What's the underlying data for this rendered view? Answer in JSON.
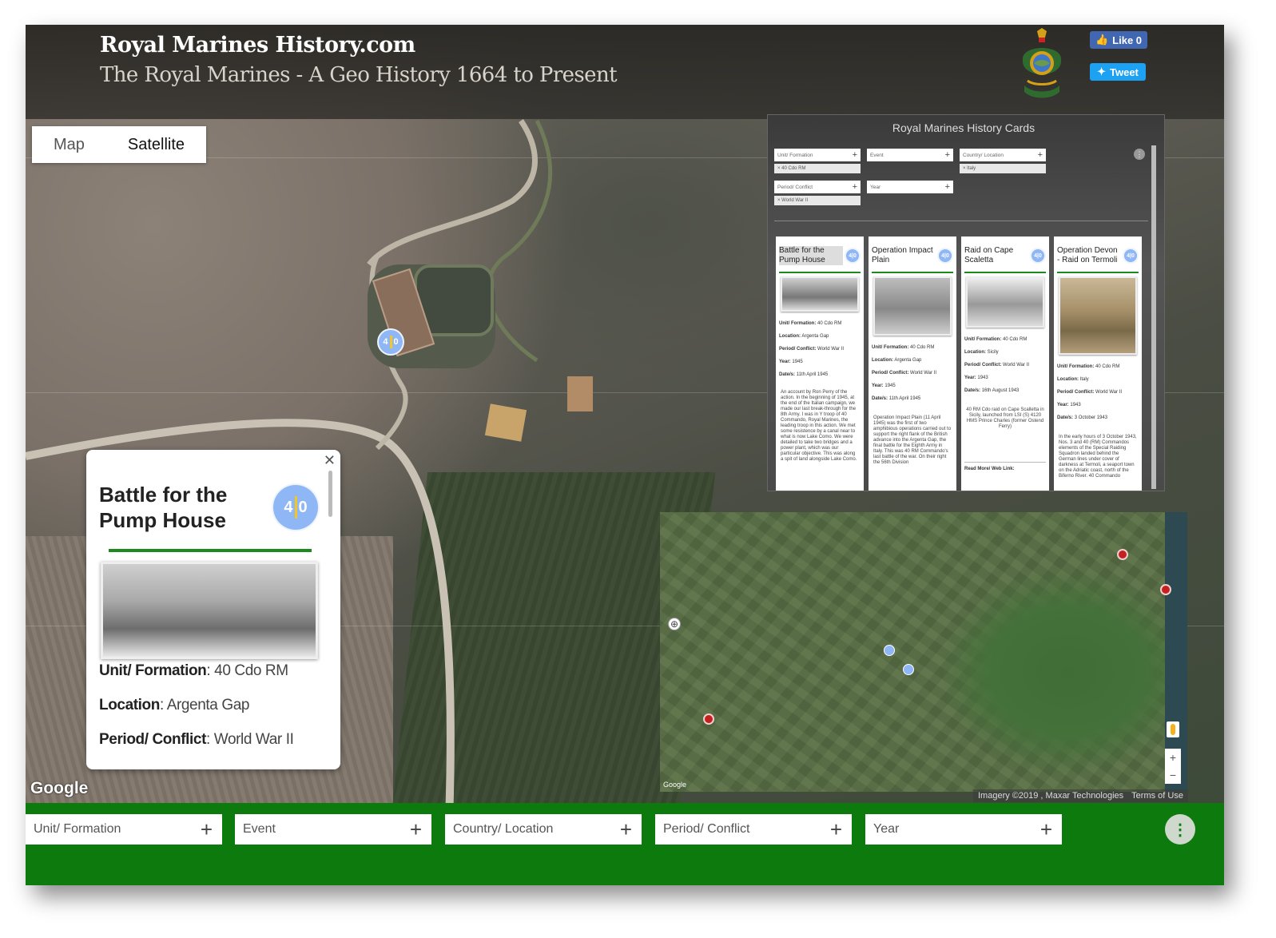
{
  "header": {
    "title": "Royal Marines History.com",
    "subtitle": "The Royal Marines - A Geo History 1664 to Present",
    "like_label": "Like 0",
    "tweet_label": "Tweet"
  },
  "map_type": {
    "options": [
      "Map",
      "Satellite"
    ],
    "selected": "Satellite"
  },
  "map_cluster": {
    "count_a": "4",
    "count_b": "0"
  },
  "popup": {
    "title": "Battle for the Pump House",
    "cluster_a": "4",
    "cluster_b": "0",
    "fields": [
      {
        "label": "Unit/ Formation",
        "value": "40 Cdo RM"
      },
      {
        "label": "Location",
        "value": "Argenta Gap"
      },
      {
        "label": "Period/ Conflict",
        "value": "World War II"
      }
    ]
  },
  "cards_panel": {
    "title": "Royal Marines History Cards",
    "filters": [
      {
        "label": "Unit/ Formation",
        "chip": "40 Cdo RM"
      },
      {
        "label": "Event",
        "chip": ""
      },
      {
        "label": "Country/ Location",
        "chip": "Italy"
      },
      {
        "label": "Period/ Conflict",
        "chip": "World War II"
      },
      {
        "label": "Year",
        "chip": ""
      }
    ],
    "cards": [
      {
        "title": "Battle for the Pump House",
        "unit": "40 Cdo RM",
        "location": "Argenta Gap",
        "period": "World War II",
        "year": "1945",
        "dates": "11th April 1945",
        "body": "An account by Ron Perry of the action. In the beginning of 1945, at the end of the Italian campaign, we made our last break-through for the 8th Army. I was in Y troop of 40 Commando, Royal Marines, the leading troop in this action. We met some resistence by a canal near to what is now Lake Como. We were detailed to take two bridges and a power plant, which was our particular objective. This was along a spit of land alongside Lake Como."
      },
      {
        "title": "Operation Impact Plain",
        "unit": "40 Cdo RM",
        "location": "Argenta Gap",
        "period": "World War II",
        "year": "1945",
        "dates": "11th April 1945",
        "body": "Operation Impact Plain (11 April 1945) was the first of two amphibious operations carried out to support the right flank of the British advance into the Argenta Gap, the final battle for the Eighth Army in Italy. This was 40 RM Commando's last battle of the war. On their right the 56th Division"
      },
      {
        "title": "Raid on Cape Scaletta",
        "unit": "40 Cdo RM",
        "location": "Sicily",
        "period": "World War II",
        "year": "1943",
        "dates": "16th August 1943",
        "body": "40 RM Cdo raid on Cape Scalletta in Sicily, launched from LSI (S) 4120 HMS Prince Charles (former Ostend Ferry)",
        "read_more": "Read More/ Web Link:"
      },
      {
        "title": "Operation Devon - Raid on Termoli",
        "unit": "40 Cdo RM",
        "location": "Italy",
        "period": "World War II",
        "year": "1943",
        "dates": "3 October 1943",
        "body": "In the early hours of 3 October 1943, Nos. 3 and 40 (RM) Commandos elements of the Special Raiding Squadron landed behind the German lines under cover of darkness at Termoli, a seaport town on the Adriatic coast, north of the Biferno River. 40 Commando"
      }
    ],
    "labels": {
      "unit": "Unit/ Formation:",
      "location": "Location:",
      "period": "Period/ Conflict:",
      "year": "Year:",
      "dates": "Date/s:"
    }
  },
  "minimap": {
    "google": "Google"
  },
  "map_footer": {
    "google": "Google",
    "imagery": "Imagery ©2019 , Maxar Technologies",
    "terms": "Terms of Use"
  },
  "filter_bar": {
    "filters": [
      "Unit/ Formation",
      "Event",
      "Country/ Location",
      "Period/ Conflict",
      "Year"
    ]
  }
}
